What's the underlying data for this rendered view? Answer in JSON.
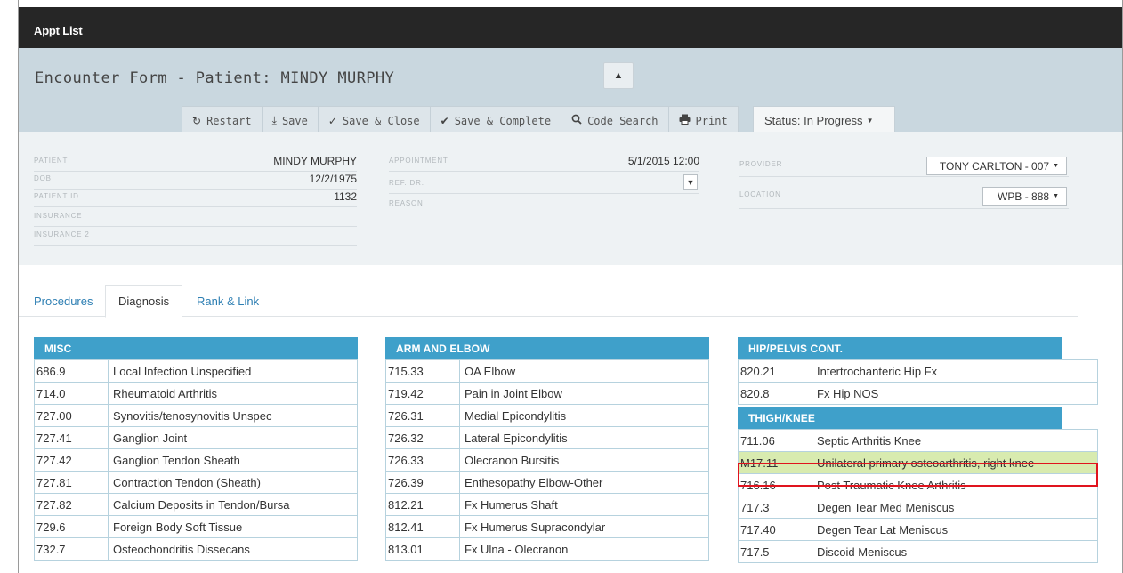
{
  "topbar": {
    "appt_list": "Appt List"
  },
  "header": {
    "title": "Encounter Form - Patient: MINDY MURPHY",
    "collapse_icon": "chevron-up-icon"
  },
  "toolbar": {
    "buttons": [
      {
        "icon": "restart-icon",
        "label": "Restart"
      },
      {
        "icon": "save-icon",
        "label": "Save"
      },
      {
        "icon": "save-close-icon",
        "label": "Save & Close"
      },
      {
        "icon": "check-circle-icon",
        "label": "Save & Complete"
      },
      {
        "icon": "search-icon",
        "label": "Code Search"
      },
      {
        "icon": "print-icon",
        "label": "Print"
      }
    ],
    "status": "Status: In Progress"
  },
  "patient": {
    "patient_label": "PATIENT",
    "patient_value": "MINDY MURPHY",
    "dob_label": "DOB",
    "dob_value": "12/2/1975",
    "id_label": "PATIENT ID",
    "id_value": "1132",
    "ins_label": "INSURANCE",
    "ins_value": "",
    "ins2_label": "INSURANCE 2",
    "ins2_value": ""
  },
  "appointment": {
    "appt_label": "APPOINTMENT",
    "appt_value": "5/1/2015 12:00",
    "ref_label": "REF. DR.",
    "ref_value": "",
    "reason_label": "REASON",
    "reason_value": ""
  },
  "provider": {
    "provider_label": "PROVIDER",
    "provider_value": "TONY CARLTON - 007",
    "location_label": "LOCATION",
    "location_value": "WPB - 888"
  },
  "tabs": [
    "Procedures",
    "Diagnosis",
    "Rank & Link"
  ],
  "active_tab": "Diagnosis",
  "sections": {
    "misc": {
      "title": "MISC",
      "rows": [
        [
          "686.9",
          "Local Infection Unspecified"
        ],
        [
          "714.0",
          "Rheumatoid Arthritis"
        ],
        [
          "727.00",
          "Synovitis/tenosynovitis Unspec"
        ],
        [
          "727.41",
          "Ganglion Joint"
        ],
        [
          "727.42",
          "Ganglion Tendon Sheath"
        ],
        [
          "727.81",
          "Contraction Tendon (Sheath)"
        ],
        [
          "727.82",
          "Calcium Deposits in Tendon/Bursa"
        ],
        [
          "729.6",
          "Foreign Body Soft Tissue"
        ],
        [
          "732.7",
          "Osteochondritis Dissecans"
        ]
      ]
    },
    "arm_elbow": {
      "title": "ARM AND ELBOW",
      "rows": [
        [
          "715.33",
          "OA Elbow"
        ],
        [
          "719.42",
          "Pain in Joint Elbow"
        ],
        [
          "726.31",
          "Medial Epicondylitis"
        ],
        [
          "726.32",
          "Lateral Epicondylitis"
        ],
        [
          "726.33",
          "Olecranon Bursitis"
        ],
        [
          "726.39",
          "Enthesopathy Elbow-Other"
        ],
        [
          "812.21",
          "Fx Humerus Shaft"
        ],
        [
          "812.41",
          "Fx Humerus Supracondylar"
        ],
        [
          "813.01",
          "Fx Ulna - Olecranon"
        ]
      ]
    },
    "hip_pelvis": {
      "title": "HIP/PELVIS CONT.",
      "rows": [
        [
          "820.21",
          "Intertrochanteric Hip Fx"
        ],
        [
          "820.8",
          "Fx Hip NOS"
        ]
      ]
    },
    "thigh_knee": {
      "title": "THIGH/KNEE",
      "highlighted_code": "M17.11",
      "rows": [
        [
          "711.06",
          "Septic Arthritis Knee"
        ],
        [
          "M17.11",
          "Unilateral primary osteoarthritis, right knee"
        ],
        [
          "716.16",
          "Post Traumatic Knee Arthritis"
        ],
        [
          "717.3",
          "Degen Tear Med Meniscus"
        ],
        [
          "717.40",
          "Degen Tear Lat Meniscus"
        ],
        [
          "717.5",
          "Discoid Meniscus"
        ]
      ]
    }
  },
  "colors": {
    "accent": "#3fa0ca",
    "highlight": "#d8ebaf",
    "highlight_border": "#e0141e"
  }
}
